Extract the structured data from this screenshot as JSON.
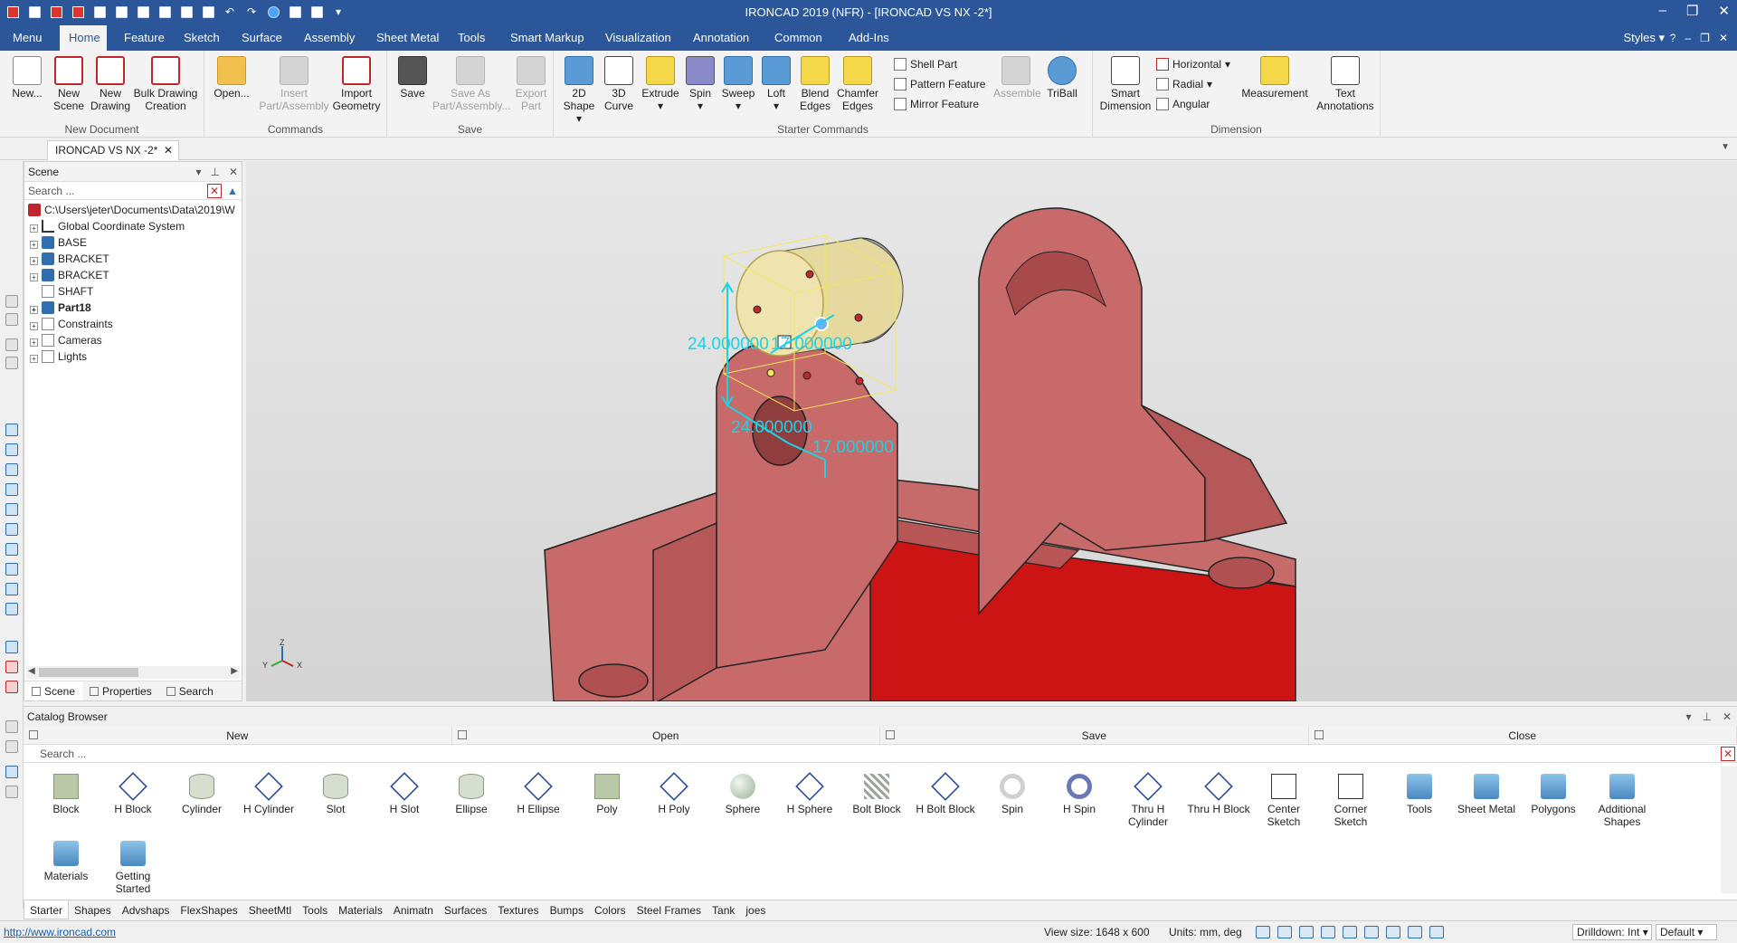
{
  "window": {
    "title": "IRONCAD 2019 (NFR) - [IRONCAD VS NX -2*]"
  },
  "menu_tabs": [
    "Menu",
    "Home",
    "Feature",
    "Sketch",
    "Surface",
    "Assembly",
    "Sheet Metal",
    "Tools",
    "Smart Markup",
    "Visualization",
    "Annotation",
    "Common",
    "Add-Ins"
  ],
  "active_tab": "Home",
  "styles_label": "Styles",
  "ribbon": {
    "new_document": {
      "label": "New Document",
      "buttons": [
        "New...",
        "New Scene",
        "New Drawing",
        "Bulk Drawing Creation"
      ]
    },
    "commands": {
      "label": "Commands",
      "buttons": [
        "Open...",
        "Insert Part/Assembly",
        "Import Geometry"
      ]
    },
    "save": {
      "label": "Save",
      "buttons": [
        "Save",
        "Save As Part/Assembly...",
        "Export Part"
      ]
    },
    "starter": {
      "label": "Starter Commands",
      "buttons": [
        "2D Shape",
        "3D Curve",
        "Extrude",
        "Spin",
        "Sweep",
        "Loft",
        "Blend Edges",
        "Chamfer Edges"
      ],
      "small": [
        "Shell Part",
        "Pattern Feature",
        "Mirror Feature"
      ],
      "extra": [
        "Assemble",
        "TriBall"
      ]
    },
    "dimension": {
      "label": "Dimension",
      "big": [
        "Smart Dimension",
        "Measurement",
        "Text Annotations"
      ],
      "small": [
        "Horizontal",
        "Radial",
        "Angular"
      ]
    }
  },
  "document_tab": "IRONCAD VS NX -2*",
  "scene": {
    "title": "Scene",
    "search_placeholder": "Search ...",
    "tree": [
      {
        "label": "C:\\Users\\jeter\\Documents\\Data\\2019\\W",
        "icon": "ironcad-logo-icon",
        "bold": false
      },
      {
        "label": "Global Coordinate System",
        "icon": "axis-icon",
        "bold": false
      },
      {
        "label": "BASE",
        "icon": "part-icon",
        "bold": false
      },
      {
        "label": "BRACKET",
        "icon": "part-icon",
        "bold": false
      },
      {
        "label": "BRACKET",
        "icon": "part-icon",
        "bold": false
      },
      {
        "label": "SHAFT",
        "icon": "part-icon",
        "bold": false
      },
      {
        "label": "Part18",
        "icon": "part-icon",
        "bold": true
      },
      {
        "label": "Constraints",
        "icon": "constraints-icon",
        "bold": false
      },
      {
        "label": "Cameras",
        "icon": "camera-icon",
        "bold": false
      },
      {
        "label": "Lights",
        "icon": "light-icon",
        "bold": false
      }
    ],
    "bottom_tabs": [
      "Scene",
      "Properties",
      "Search"
    ]
  },
  "viewport": {
    "dimensions": [
      "24.000000",
      "17.000000",
      "24.000000",
      "17.000000"
    ],
    "axis_labels": [
      "Z",
      "Y",
      "X"
    ],
    "colors": {
      "part": "#c96a6a",
      "part_dark": "#b24848",
      "base_red": "#cc1414",
      "shaft": "#e6d9a0",
      "dimension": "#19d3e8"
    }
  },
  "catalog": {
    "title": "Catalog Browser",
    "commands": [
      "New",
      "Open",
      "Save",
      "Close"
    ],
    "search_placeholder": "Search ...",
    "items": [
      "Block",
      "H Block",
      "Cylinder",
      "H Cylinder",
      "Slot",
      "H Slot",
      "Ellipse",
      "H Ellipse",
      "Poly",
      "H Poly",
      "Sphere",
      "H Sphere",
      "Bolt Block",
      "H Bolt Block",
      "Spin",
      "H Spin",
      "Thru H Cylinder",
      "Thru H Block",
      "Center Sketch",
      "Corner Sketch",
      "Tools",
      "Sheet Metal",
      "Polygons",
      "Additional Shapes",
      "Materials",
      "Getting Started"
    ],
    "tabs": [
      "Starter",
      "Shapes",
      "Advshaps",
      "FlexShapes",
      "SheetMtl",
      "Tools",
      "Materials",
      "Animatn",
      "Surfaces",
      "Textures",
      "Bumps",
      "Colors",
      "Steel Frames",
      "Tank",
      "joes"
    ],
    "active_tab": "Starter"
  },
  "status": {
    "url": "http://www.ironcad.com",
    "view_size": "View size: 1648 x 600",
    "units": "Units: mm, deg",
    "drilldown": "Drilldown: Int",
    "default": "Default"
  }
}
